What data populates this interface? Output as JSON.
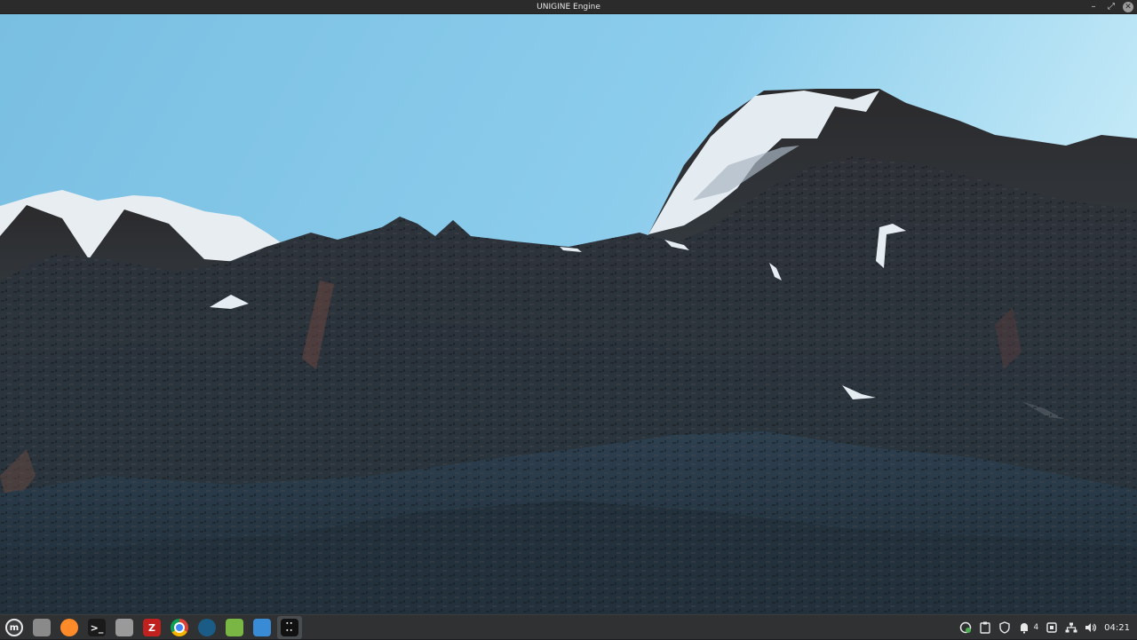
{
  "window": {
    "title": "UNIGINE Engine",
    "controls": {
      "minimize": "–",
      "restore": "⤢",
      "close": "✕"
    }
  },
  "viewport": {
    "scene": "terrain-render",
    "sky_top": "#7cc3e6",
    "sky_horizon": "#a8dcf2",
    "rock": "#2e3840",
    "snow": "#e9eef2"
  },
  "taskbar": {
    "apps": [
      {
        "name": "mint-menu-icon",
        "glyph": "m",
        "color": "#3d3f41"
      },
      {
        "name": "show-desktop-icon",
        "glyph": "",
        "color": "#8a8a8a"
      },
      {
        "name": "firefox-icon",
        "glyph": "",
        "color": "#ff8a2a"
      },
      {
        "name": "terminal-icon",
        "glyph": ">_",
        "color": "#1a1a1a"
      },
      {
        "name": "files-icon",
        "glyph": "",
        "color": "#9a9a9a"
      },
      {
        "name": "filezilla-icon",
        "glyph": "Z",
        "color": "#c0201e"
      },
      {
        "name": "chrome-icon",
        "glyph": "",
        "color": "#e8e8e8"
      },
      {
        "name": "steam-icon",
        "glyph": "",
        "color": "#1b5c86"
      },
      {
        "name": "software-manager-icon",
        "glyph": "",
        "color": "#7ab644"
      },
      {
        "name": "editor-icon",
        "glyph": "",
        "color": "#3a8bd6"
      },
      {
        "name": "unigine-icon",
        "glyph": "",
        "color": "#111111"
      }
    ],
    "tray": {
      "notification_count": "4",
      "clock": "04:21"
    }
  }
}
